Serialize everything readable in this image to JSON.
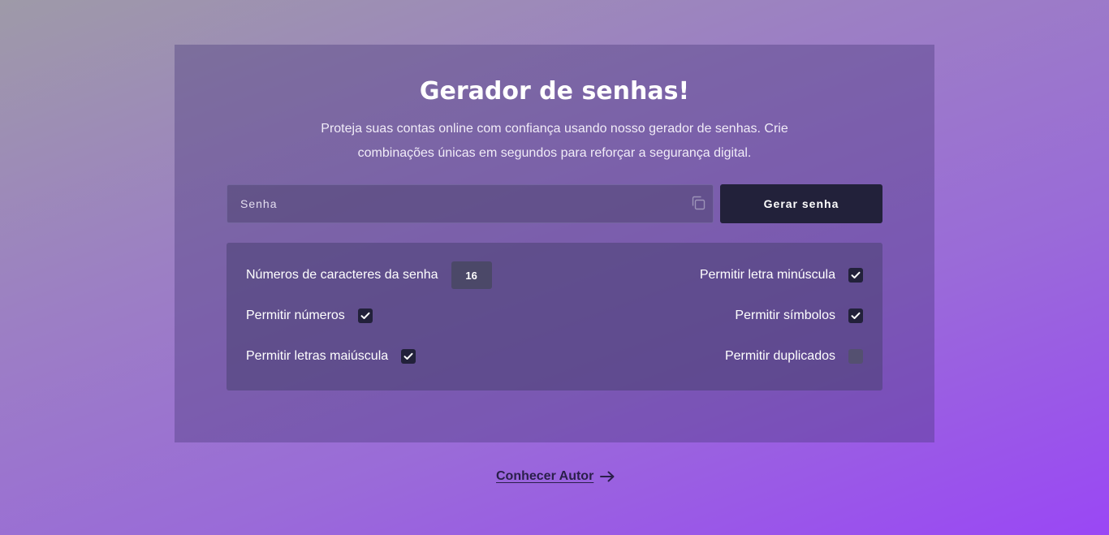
{
  "header": {
    "title": "Gerador de senhas!",
    "subtitle": "Proteja suas contas online com confiança usando nosso gerador de senhas. Crie combinações únicas em segundos para reforçar a segurança digital."
  },
  "password": {
    "placeholder": "Senha",
    "value": "",
    "copy_icon": "copy-icon"
  },
  "generate_button": {
    "label": "Gerar senha"
  },
  "options": {
    "length_label": "Números de caracteres da senha",
    "length_value": "16",
    "numbers_label": "Permitir números",
    "numbers_checked": true,
    "uppercase_label": "Permitir letras maiúscula",
    "uppercase_checked": true,
    "lowercase_label": "Permitir letra minúscula",
    "lowercase_checked": true,
    "symbols_label": "Permitir símbolos",
    "symbols_checked": true,
    "duplicates_label": "Permitir duplicados",
    "duplicates_checked": false
  },
  "footer": {
    "author_link": "Conhecer Autor",
    "arrow_icon": "arrow-right-icon"
  },
  "colors": {
    "button_dark": "#22213a",
    "checkbox_on": "#22213a",
    "checkbox_off": "#545070",
    "link": "#2a1f4a"
  }
}
